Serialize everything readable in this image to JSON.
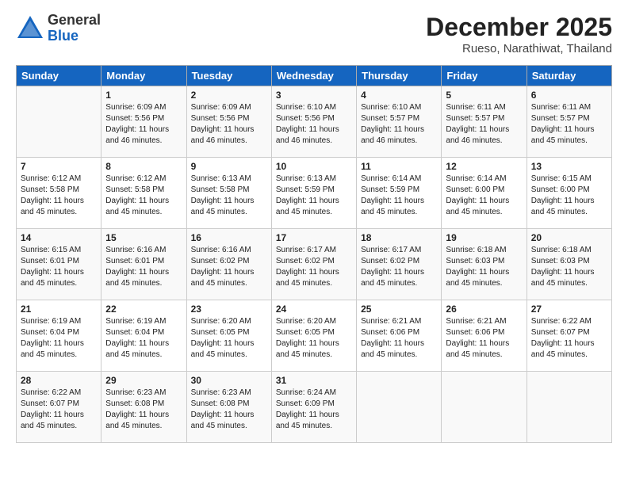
{
  "logo": {
    "general": "General",
    "blue": "Blue"
  },
  "title": "December 2025",
  "location": "Rueso, Narathiwat, Thailand",
  "weekdays": [
    "Sunday",
    "Monday",
    "Tuesday",
    "Wednesday",
    "Thursday",
    "Friday",
    "Saturday"
  ],
  "weeks": [
    [
      {
        "day": "",
        "info": ""
      },
      {
        "day": "1",
        "info": "Sunrise: 6:09 AM\nSunset: 5:56 PM\nDaylight: 11 hours\nand 46 minutes."
      },
      {
        "day": "2",
        "info": "Sunrise: 6:09 AM\nSunset: 5:56 PM\nDaylight: 11 hours\nand 46 minutes."
      },
      {
        "day": "3",
        "info": "Sunrise: 6:10 AM\nSunset: 5:56 PM\nDaylight: 11 hours\nand 46 minutes."
      },
      {
        "day": "4",
        "info": "Sunrise: 6:10 AM\nSunset: 5:57 PM\nDaylight: 11 hours\nand 46 minutes."
      },
      {
        "day": "5",
        "info": "Sunrise: 6:11 AM\nSunset: 5:57 PM\nDaylight: 11 hours\nand 46 minutes."
      },
      {
        "day": "6",
        "info": "Sunrise: 6:11 AM\nSunset: 5:57 PM\nDaylight: 11 hours\nand 45 minutes."
      }
    ],
    [
      {
        "day": "7",
        "info": "Sunrise: 6:12 AM\nSunset: 5:58 PM\nDaylight: 11 hours\nand 45 minutes."
      },
      {
        "day": "8",
        "info": "Sunrise: 6:12 AM\nSunset: 5:58 PM\nDaylight: 11 hours\nand 45 minutes."
      },
      {
        "day": "9",
        "info": "Sunrise: 6:13 AM\nSunset: 5:58 PM\nDaylight: 11 hours\nand 45 minutes."
      },
      {
        "day": "10",
        "info": "Sunrise: 6:13 AM\nSunset: 5:59 PM\nDaylight: 11 hours\nand 45 minutes."
      },
      {
        "day": "11",
        "info": "Sunrise: 6:14 AM\nSunset: 5:59 PM\nDaylight: 11 hours\nand 45 minutes."
      },
      {
        "day": "12",
        "info": "Sunrise: 6:14 AM\nSunset: 6:00 PM\nDaylight: 11 hours\nand 45 minutes."
      },
      {
        "day": "13",
        "info": "Sunrise: 6:15 AM\nSunset: 6:00 PM\nDaylight: 11 hours\nand 45 minutes."
      }
    ],
    [
      {
        "day": "14",
        "info": "Sunrise: 6:15 AM\nSunset: 6:01 PM\nDaylight: 11 hours\nand 45 minutes."
      },
      {
        "day": "15",
        "info": "Sunrise: 6:16 AM\nSunset: 6:01 PM\nDaylight: 11 hours\nand 45 minutes."
      },
      {
        "day": "16",
        "info": "Sunrise: 6:16 AM\nSunset: 6:02 PM\nDaylight: 11 hours\nand 45 minutes."
      },
      {
        "day": "17",
        "info": "Sunrise: 6:17 AM\nSunset: 6:02 PM\nDaylight: 11 hours\nand 45 minutes."
      },
      {
        "day": "18",
        "info": "Sunrise: 6:17 AM\nSunset: 6:02 PM\nDaylight: 11 hours\nand 45 minutes."
      },
      {
        "day": "19",
        "info": "Sunrise: 6:18 AM\nSunset: 6:03 PM\nDaylight: 11 hours\nand 45 minutes."
      },
      {
        "day": "20",
        "info": "Sunrise: 6:18 AM\nSunset: 6:03 PM\nDaylight: 11 hours\nand 45 minutes."
      }
    ],
    [
      {
        "day": "21",
        "info": "Sunrise: 6:19 AM\nSunset: 6:04 PM\nDaylight: 11 hours\nand 45 minutes."
      },
      {
        "day": "22",
        "info": "Sunrise: 6:19 AM\nSunset: 6:04 PM\nDaylight: 11 hours\nand 45 minutes."
      },
      {
        "day": "23",
        "info": "Sunrise: 6:20 AM\nSunset: 6:05 PM\nDaylight: 11 hours\nand 45 minutes."
      },
      {
        "day": "24",
        "info": "Sunrise: 6:20 AM\nSunset: 6:05 PM\nDaylight: 11 hours\nand 45 minutes."
      },
      {
        "day": "25",
        "info": "Sunrise: 6:21 AM\nSunset: 6:06 PM\nDaylight: 11 hours\nand 45 minutes."
      },
      {
        "day": "26",
        "info": "Sunrise: 6:21 AM\nSunset: 6:06 PM\nDaylight: 11 hours\nand 45 minutes."
      },
      {
        "day": "27",
        "info": "Sunrise: 6:22 AM\nSunset: 6:07 PM\nDaylight: 11 hours\nand 45 minutes."
      }
    ],
    [
      {
        "day": "28",
        "info": "Sunrise: 6:22 AM\nSunset: 6:07 PM\nDaylight: 11 hours\nand 45 minutes."
      },
      {
        "day": "29",
        "info": "Sunrise: 6:23 AM\nSunset: 6:08 PM\nDaylight: 11 hours\nand 45 minutes."
      },
      {
        "day": "30",
        "info": "Sunrise: 6:23 AM\nSunset: 6:08 PM\nDaylight: 11 hours\nand 45 minutes."
      },
      {
        "day": "31",
        "info": "Sunrise: 6:24 AM\nSunset: 6:09 PM\nDaylight: 11 hours\nand 45 minutes."
      },
      {
        "day": "",
        "info": ""
      },
      {
        "day": "",
        "info": ""
      },
      {
        "day": "",
        "info": ""
      }
    ]
  ]
}
